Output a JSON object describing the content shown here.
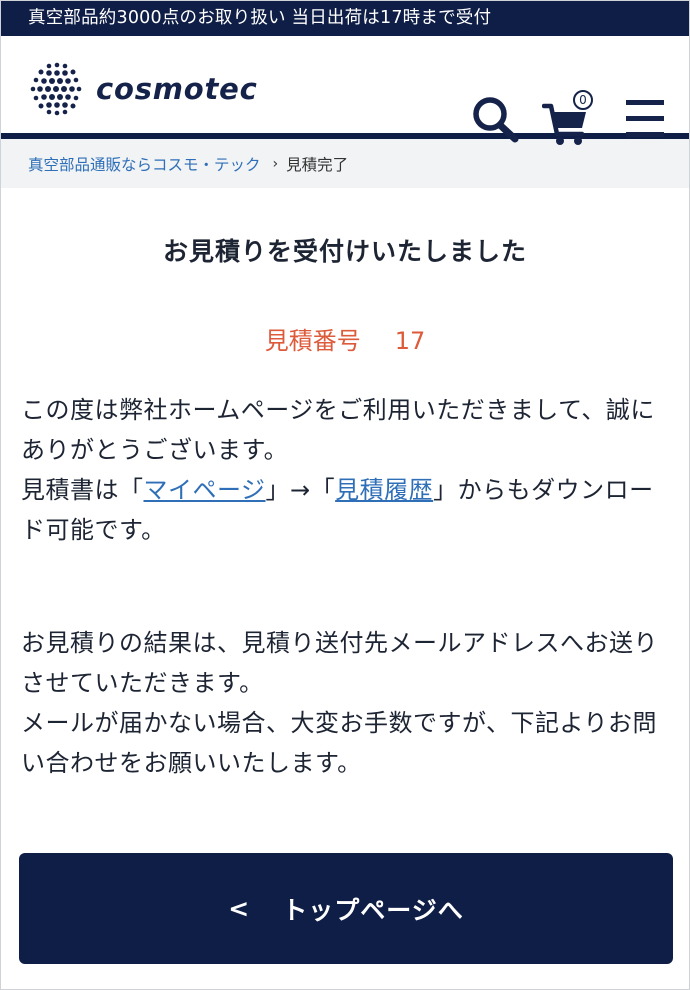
{
  "announcement": "真空部品約3000点のお取り扱い 当日出荷は17時まで受付",
  "header": {
    "logo_text": "cosmotec",
    "cart_count": "0"
  },
  "breadcrumb": {
    "home": "真空部品通販ならコスモ・テック",
    "separator": "›",
    "current": "見積完了"
  },
  "main": {
    "title": "お見積りを受付けいたしました",
    "quote_label": "見積番号",
    "quote_number": "17",
    "para1": {
      "line1": "この度は弊社ホームページをご利用いただきまして、誠にありがとうございます。",
      "line2_prefix": "見積書は「",
      "link_mypage": "マイページ",
      "line2_middle": "」→「",
      "link_history": "見積履歴",
      "line2_suffix": "」からもダウンロード可能です。"
    },
    "para2": {
      "line1": "お見積りの結果は、見積り送付先メールアドレスへお送りさせていただきます。",
      "line2": "メールが届かない場合、大変お手数ですが、下記よりお問い合わせをお願いいたします。"
    }
  },
  "top_button": {
    "chevron": "<",
    "label": "トップページへ"
  },
  "colors": {
    "navy": "#0f1e46",
    "link": "#2f6fb8",
    "accent": "#dd5b3a"
  }
}
